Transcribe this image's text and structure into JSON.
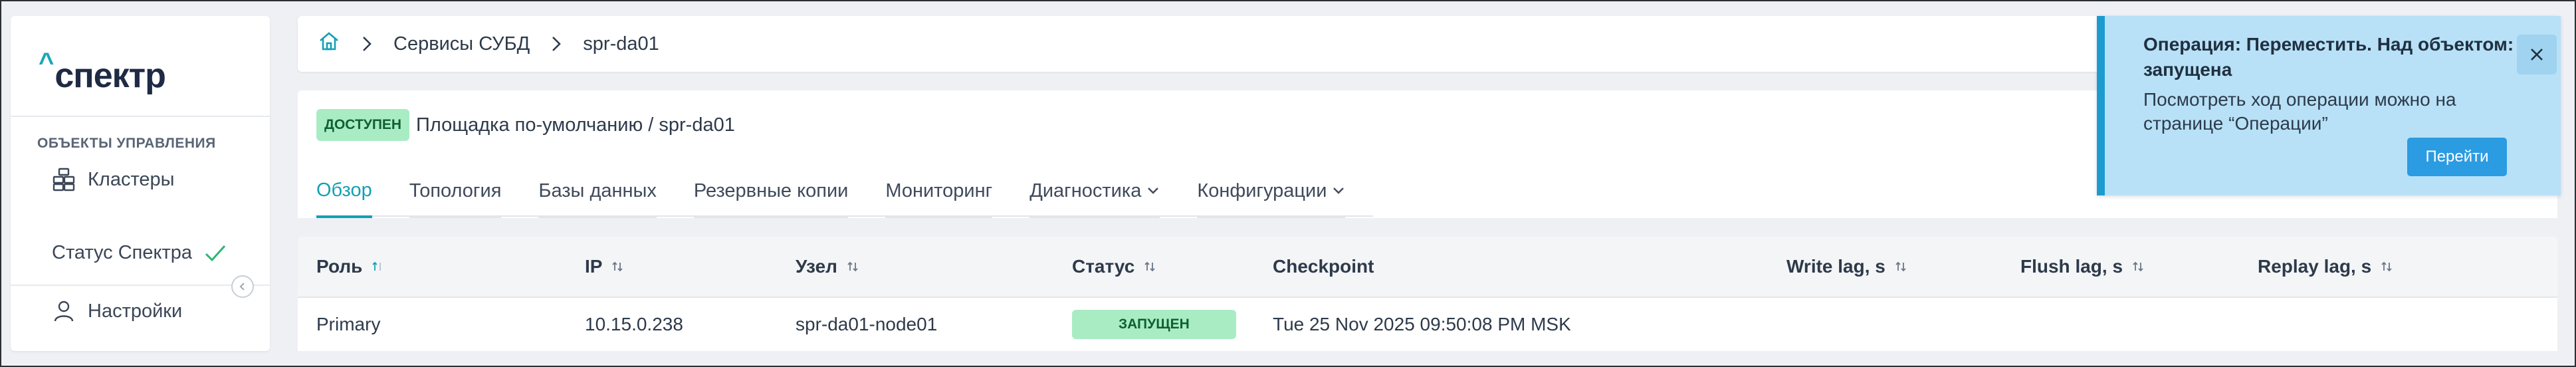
{
  "sidebar": {
    "logo_caret": "^",
    "logo_text": "спектр",
    "section_title": "ОБЪЕКТЫ УПРАВЛЕНИЯ",
    "items": [
      {
        "label": "Кластеры",
        "icon": "cluster-icon"
      },
      {
        "label": "Статус Спектра",
        "icon": "check-icon"
      },
      {
        "label": "Настройки",
        "icon": "user-icon"
      }
    ]
  },
  "breadcrumb": {
    "home_icon": "home-icon",
    "items": [
      "Сервисы СУБД",
      "spr-da01"
    ]
  },
  "object": {
    "status_badge": "ДОСТУПЕН",
    "location": "Площадка по-умолчанию /  spr-da01"
  },
  "tabs": [
    {
      "label": "Обзор",
      "active": true
    },
    {
      "label": "Топология"
    },
    {
      "label": "Базы данных"
    },
    {
      "label": "Резервные копии"
    },
    {
      "label": "Мониторинг"
    },
    {
      "label": "Диагностика",
      "dropdown": true
    },
    {
      "label": "Конфигурации",
      "dropdown": true
    }
  ],
  "table": {
    "columns": [
      "Роль",
      "IP",
      "Узел",
      "Статус",
      "Checkpoint",
      "Write lag, s",
      "Flush lag, s",
      "Replay lag, s"
    ],
    "rows": [
      {
        "role": "Primary",
        "ip": "10.15.0.238",
        "node": "spr-da01-node01",
        "status": "ЗАПУЩЕН",
        "checkpoint": "Tue 25 Nov 2025 09:50:08 PM MSK",
        "write_lag": "",
        "flush_lag": "",
        "replay_lag": ""
      }
    ]
  },
  "toast": {
    "title": "Операция: Переместить. Над объектом: запущена",
    "message": "Посмотреть ход операции можно на странице “Операции”",
    "action_label": "Перейти"
  },
  "colors": {
    "accent": "#13a0b5",
    "success_bg": "#a9ecc4",
    "info_bg": "#b8e1f7",
    "button": "#2b9be2"
  }
}
